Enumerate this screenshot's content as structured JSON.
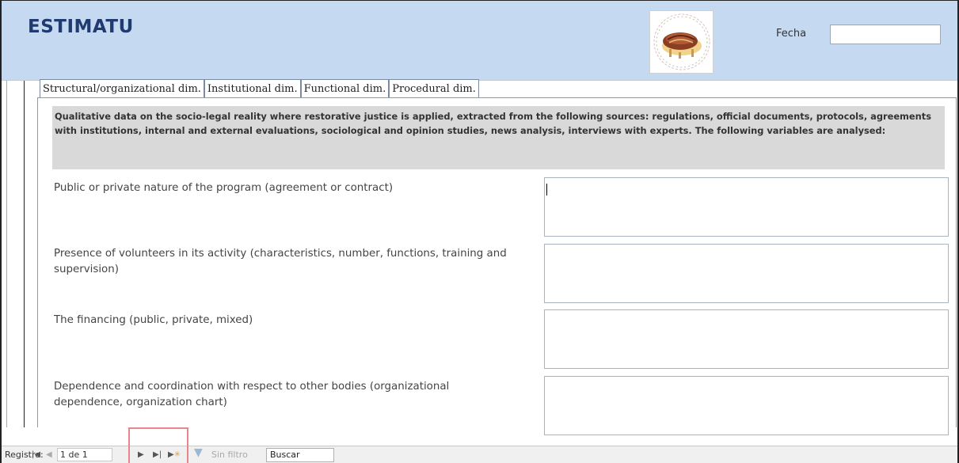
{
  "header": {
    "title": "ESTIMATU",
    "logo_icon": "caterpillar-logo-icon",
    "date_label": "Fecha",
    "date_value": ""
  },
  "tabs": [
    {
      "label": "Structural/organizational dim.",
      "active": true
    },
    {
      "label": "Institutional dim.",
      "active": false
    },
    {
      "label": "Functional dim.",
      "active": false
    },
    {
      "label": "Procedural dim.",
      "active": false
    }
  ],
  "panel": {
    "intro": "Qualitative data on the socio-legal reality where restorative justice is applied, extracted from the following sources: regulations, official documents, protocols, agreements with institutions, internal and external evaluations, sociological and opinion studies, news analysis, interviews with experts. The following variables are analysed:",
    "fields": [
      {
        "label": "Public or private nature of the program (agreement or contract)",
        "value": ""
      },
      {
        "label": "Presence of volunteers in its activity (characteristics, number, functions, training and supervision)",
        "value": ""
      },
      {
        "label": "The financing (public, private, mixed)",
        "value": ""
      },
      {
        "label": "Dependence and coordination with respect to other bodies (organizational dependence, organization chart)",
        "value": ""
      }
    ]
  },
  "navigation": {
    "record_label": "Registro:",
    "record_value": "1 de 1",
    "first_icon": "first-record-icon",
    "prev_icon": "previous-record-icon",
    "next_icon": "next-record-icon",
    "last_icon": "last-record-icon",
    "new_icon": "new-record-icon",
    "filter_icon": "filter-icon",
    "filter_label": "Sin filtro",
    "search_value": "Buscar"
  },
  "colors": {
    "header_bg": "#c5d9f1",
    "title": "#1f3b70",
    "intro_bg": "#d9d9d9",
    "highlight": "#e8878a"
  }
}
